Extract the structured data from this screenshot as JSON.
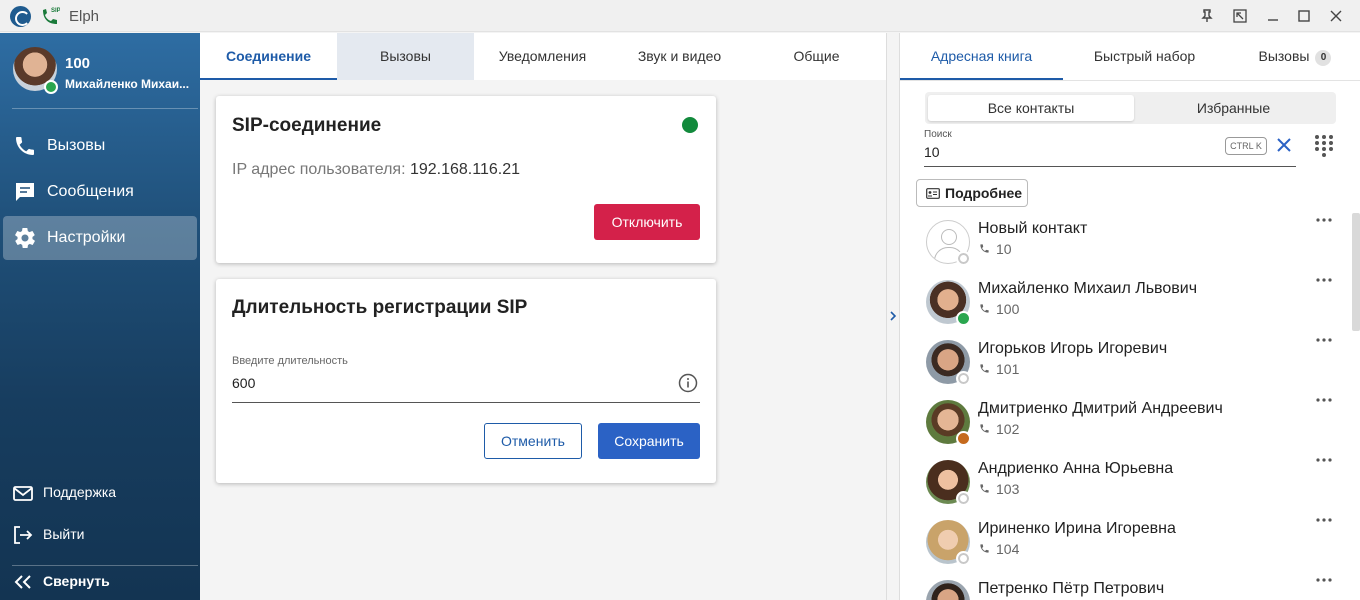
{
  "window": {
    "title": "Elph"
  },
  "user": {
    "number": "100",
    "name": "Михайленко Михаи..."
  },
  "nav": {
    "items": [
      {
        "label": "Вызовы",
        "icon": "phone-icon"
      },
      {
        "label": "Сообщения",
        "icon": "chat-icon"
      },
      {
        "label": "Настройки",
        "icon": "gear-icon",
        "active": true
      }
    ],
    "footer": [
      {
        "label": "Поддержка",
        "icon": "mail-icon"
      },
      {
        "label": "Выйти",
        "icon": "logout-icon"
      },
      {
        "label": "Свернуть",
        "icon": "double-chevron-left-icon"
      }
    ]
  },
  "main": {
    "tabs": [
      {
        "label": "Соединение",
        "active": true
      },
      {
        "label": "Вызовы"
      },
      {
        "label": "Уведомления"
      },
      {
        "label": "Звук и видео"
      },
      {
        "label": "Общие"
      }
    ],
    "sip_card": {
      "title": "SIP-соединение",
      "status_color": "#128a3c",
      "ip_label": "IP адрес пользователя:",
      "ip_value": "192.168.116.21",
      "disconnect_label": "Отключить"
    },
    "reg_card": {
      "title": "Длительность регистрации SIP",
      "field_label": "Введите длительность",
      "field_value": "600",
      "cancel_label": "Отменить",
      "save_label": "Сохранить"
    }
  },
  "right": {
    "tabs": [
      {
        "label": "Адресная книга",
        "active": true
      },
      {
        "label": "Быстрый набор"
      },
      {
        "label": "Вызовы",
        "count": "0"
      }
    ],
    "segments": [
      {
        "label": "Все контакты",
        "active": true
      },
      {
        "label": "Избранные"
      }
    ],
    "search": {
      "label": "Поиск",
      "value": "10",
      "shortcut": "CTRL K"
    },
    "details_label": "Подробнее",
    "contacts": [
      {
        "name": "Новый контакт",
        "number": "10",
        "status": "offline"
      },
      {
        "name": "Михайленко Михаил Львович",
        "number": "100",
        "status": "online"
      },
      {
        "name": "Игорьков Игорь Игоревич",
        "number": "101",
        "status": "offline"
      },
      {
        "name": "Дмитриенко Дмитрий Андреевич",
        "number": "102",
        "status": "away"
      },
      {
        "name": "Андриенко Анна Юрьевна",
        "number": "103",
        "status": "offline"
      },
      {
        "name": "Ириненко Ирина Игоревна",
        "number": "104",
        "status": "offline"
      },
      {
        "name": "Петренко Пётр Петрович",
        "number": "",
        "status": "offline"
      }
    ]
  },
  "colors": {
    "accent": "#1e5ba8",
    "danger": "#d4214a",
    "primary": "#2b62c5",
    "online": "#2aa64f",
    "away": "#c56a1d"
  }
}
